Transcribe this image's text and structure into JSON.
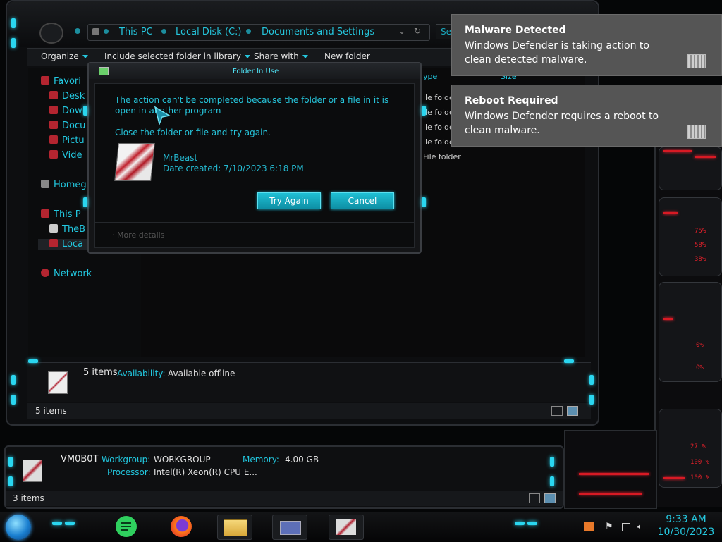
{
  "explorer": {
    "address": {
      "crumbs": [
        "This PC",
        "Local Disk (C:)",
        "Documents and Settings"
      ],
      "search_placeholder": "Sea"
    },
    "toolbar": {
      "organize": "Organize",
      "include_library": "Include selected folder in library",
      "share_with": "Share with",
      "new_folder": "New folder"
    },
    "nav": {
      "favorites": "Favori",
      "desktop": "Desk",
      "downloads": "Dow",
      "documents": "Docu",
      "pictures": "Pictu",
      "videos": "Vide",
      "homegroup": "Homeg",
      "this_pc": "This P",
      "thebox": "TheB",
      "local": "Loca",
      "network": "Network"
    },
    "columns": {
      "type": "ype",
      "size": "Size"
    },
    "rows": [
      "ile folder",
      "ile folder",
      "ile folder",
      "ile folder",
      "File folder"
    ],
    "details": {
      "count": "5 items",
      "availability_label": "Availability:",
      "availability_value": "Available offline"
    },
    "status": "5 items"
  },
  "dialog": {
    "title": "Folder In Use",
    "message": "The action can't be completed because the folder or a file in it is open in another program",
    "instruction": "Close the folder or file and try again.",
    "item_name": "MrBeast",
    "item_date": "Date created: 7/10/2023 6:18 PM",
    "try_again": "Try Again",
    "cancel": "Cancel",
    "more_details": "More details"
  },
  "toasts": [
    {
      "title": "Malware Detected",
      "message": "Windows Defender is taking action to clean detected malware."
    },
    {
      "title": "Reboot Required",
      "message": "Windows Defender requires a reboot to clean malware."
    }
  ],
  "thispc": {
    "name": "VM0B0T",
    "workgroup_label": "Workgroup:",
    "workgroup_value": "WORKGROUP",
    "memory_label": "Memory:",
    "memory_value": "4.00 GB",
    "processor_label": "Processor:",
    "processor_value": "Intel(R) Xeon(R) CPU E...",
    "status": "3 items"
  },
  "hud": {
    "values": [
      "75%",
      "58%",
      "38%",
      "0%",
      "0%",
      "27 %",
      "100 %",
      "100 %"
    ]
  },
  "taskbar": {
    "time": "9:33 AM",
    "date": "10/30/2023"
  },
  "colors": {
    "accent": "#22c8e0",
    "hud_red": "#e2202a",
    "toast_bg": "#555555"
  }
}
